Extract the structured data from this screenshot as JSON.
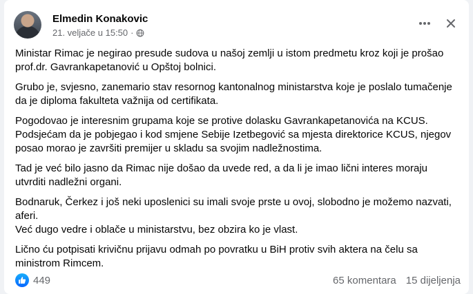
{
  "post": {
    "author": "Elmedin Konakovic",
    "timestamp": "21. veljače u 15:50",
    "separator": "·",
    "privacy_icon": "globe-icon",
    "paragraphs": [
      "Ministar Rimac je negirao presude sudova u našoj zemlji u istom predmetu kroz koji je prošao prof.dr. Gavrankapetanović u Opštoj bolnici.",
      "Grubo je, svjesno, zanemario stav resornog kantonalnog ministarstva koje je poslalo tumačenje da je diploma fakulteta važnija od certifikata.",
      "Pogodovao je interesnim grupama koje se protive dolasku Gavrankapetanovića na KCUS.\nPodsjećam da je pobjegao i kod smjene Sebije Izetbegović sa mjesta direktorice KCUS, njegov posao morao je završiti premijer u skladu sa svojim nadležnostima.",
      "Tad je već bilo jasno da Rimac nije došao da uvede red, a da li je imao lični interes moraju utvrditi nadležni organi.",
      "Bodnaruk, Čerkez i još neki uposlenici su imali svoje prste u ovoj, slobodno je možemo nazvati, aferi.\nVeć dugo vedre i oblače u ministarstvu, bez obzira ko je vlast.",
      "Lično ću potpisati krivičnu prijavu odmah po povratku u BiH protiv svih aktera na čelu sa ministrom Rimcem."
    ]
  },
  "footer": {
    "reaction_icon": "like-icon",
    "reaction_count": "449",
    "comments": "65 komentara",
    "shares": "15 dijeljenja"
  },
  "colors": {
    "accent": "#0866ff",
    "secondary_text": "#65676b",
    "background": "#f0f2f5"
  }
}
